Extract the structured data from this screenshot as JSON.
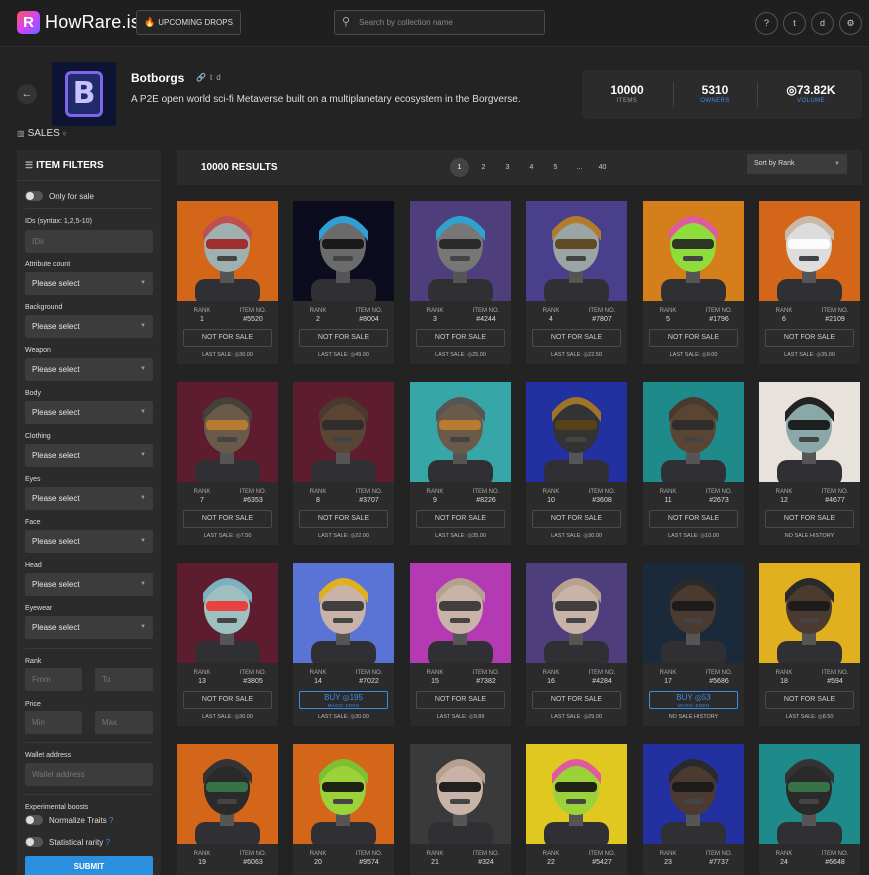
{
  "header": {
    "logo_letter": "R",
    "app_name": "HowRare.is",
    "upcoming_drops": "UPCOMING DROPS",
    "search_placeholder": "Search by collection name",
    "icons": [
      "help-icon",
      "twitter-icon",
      "discord-icon",
      "settings-icon"
    ],
    "icon_glyphs": [
      "?",
      "t",
      "d",
      "⚙"
    ]
  },
  "collection": {
    "name": "Botborgs",
    "logo_letter": "B",
    "links": [
      "link-icon",
      "twitter-icon",
      "discord-icon"
    ],
    "description": "A P2E open world sci-fi Metaverse built on a multiplanetary ecosystem in the Borgverse.",
    "stats": [
      {
        "value": "10000",
        "label": "ITEMS",
        "color": "#9a9a9a"
      },
      {
        "value": "5310",
        "label": "OWNERS",
        "color": "#3a8ee6"
      },
      {
        "value": "◎73.82K",
        "label": "VOLUME",
        "color": "#3a8ee6"
      }
    ]
  },
  "sales_label": "SALES",
  "filters": {
    "title": "ITEM FILTERS",
    "only_for_sale": "Only for sale",
    "ids_label": "IDs (syntax: 1,2,5-10)",
    "ids_placeholder": "IDs",
    "select_placeholder": "Please select",
    "attributes": [
      "Attribute count",
      "Background",
      "Weapon",
      "Body",
      "Clothing",
      "Eyes",
      "Face",
      "Head",
      "Eyewear"
    ],
    "rank_label": "Rank",
    "rank_from": "From",
    "rank_to": "To",
    "price_label": "Price",
    "price_min": "Min",
    "price_max": "Max",
    "wallet_label": "Wallet address",
    "wallet_placeholder": "Wallet address",
    "experimental_label": "Experimental boosts",
    "normalize_traits": "Normalize Traits",
    "statistical_rarity": "Statistical rarity",
    "help_mark": "?",
    "submit": "SUBMIT"
  },
  "results": {
    "count_text": "10000 RESULTS",
    "pages": [
      "1",
      "2",
      "3",
      "4",
      "5",
      "...",
      "40"
    ],
    "active_page": "1",
    "sort": "Sort by Rank"
  },
  "labels": {
    "rank": "RANK",
    "item_no": "ITEM NO.",
    "magic_eden": "MAGIC EDEN"
  },
  "items": [
    {
      "rank": "1",
      "item": "#5520",
      "sale": "NOT FOR SALE",
      "last": "LAST SALE: ◎30.00",
      "bg": "#d4661a",
      "skin": "#9fb0b0",
      "helmet": "#c05050",
      "visor": "#a02020"
    },
    {
      "rank": "2",
      "item": "#8004",
      "sale": "NOT FOR SALE",
      "last": "LAST SALE: ◎49.00",
      "bg": "#0b0d1e",
      "skin": "#6b6b6b",
      "helmet": "#2f9fd6",
      "visor": "#111"
    },
    {
      "rank": "3",
      "item": "#4244",
      "sale": "NOT FOR SALE",
      "last": "LAST SALE: ◎25.00",
      "bg": "#4e3f7c",
      "skin": "#777",
      "helmet": "#2fa3d0",
      "visor": "#222"
    },
    {
      "rank": "4",
      "item": "#7807",
      "sale": "NOT FOR SALE",
      "last": "LAST SALE: ◎22.50",
      "bg": "#4a3f8a",
      "skin": "#9aa6a6",
      "helmet": "#b07c2a",
      "visor": "#5a4216"
    },
    {
      "rank": "5",
      "item": "#1796",
      "sale": "NOT FOR SALE",
      "last": "LAST SALE: ◎9.00",
      "bg": "#d47f1c",
      "skin": "#8edd3a",
      "helmet": "#e05aa0",
      "visor": "#222"
    },
    {
      "rank": "6",
      "item": "#2109",
      "sale": "NOT FOR SALE",
      "last": "LAST SALE: ◎35.00",
      "bg": "#d4661a",
      "skin": "#ddd",
      "helmet": "#c9b9a8",
      "visor": "#fff"
    },
    {
      "rank": "7",
      "item": "#6353",
      "sale": "NOT FOR SALE",
      "last": "LAST SALE: ◎7.50",
      "bg": "#5e1d2e",
      "skin": "#6a5a4a",
      "helmet": "#44403a",
      "visor": "#c08030"
    },
    {
      "rank": "8",
      "item": "#3707",
      "sale": "NOT FOR SALE",
      "last": "LAST SALE: ◎22.00",
      "bg": "#5e1d2e",
      "skin": "#5a4434",
      "helmet": "#4a3a2e",
      "visor": "#2a2a2a"
    },
    {
      "rank": "9",
      "item": "#8226",
      "sale": "NOT FOR SALE",
      "last": "LAST SALE: ◎35.00",
      "bg": "#37a6a6",
      "skin": "#6a5a4a",
      "helmet": "#555",
      "visor": "#c08030"
    },
    {
      "rank": "10",
      "item": "#3608",
      "sale": "NOT FOR SALE",
      "last": "LAST SALE: ◎30.00",
      "bg": "#2230a0",
      "skin": "#333",
      "helmet": "#a07428",
      "visor": "#5a4216"
    },
    {
      "rank": "11",
      "item": "#2673",
      "sale": "NOT FOR SALE",
      "last": "LAST SALE: ◎10.00",
      "bg": "#1e8a8a",
      "skin": "#5a4434",
      "helmet": "#4a3a2e",
      "visor": "#2a2a2a"
    },
    {
      "rank": "12",
      "item": "#4677",
      "sale": "NOT FOR SALE",
      "last": "NO SALE HISTORY",
      "bg": "#e7e2dc",
      "skin": "#8aa8a8",
      "helmet": "#222",
      "visor": "#111"
    },
    {
      "rank": "13",
      "item": "#3805",
      "sale": "NOT FOR SALE",
      "last": "LAST SALE: ◎30.00",
      "bg": "#5e1d2e",
      "skin": "#9fc0c0",
      "helmet": "#7fb0c0",
      "visor": "#e33"
    },
    {
      "rank": "14",
      "item": "#7022",
      "sale": "BUY ◎195",
      "last": "LAST SALE: ◎30.00",
      "bg": "#5a74d6",
      "skin": "#c9b3a8",
      "helmet": "#e0b020",
      "visor": "#333"
    },
    {
      "rank": "15",
      "item": "#7382",
      "sale": "NOT FOR SALE",
      "last": "LAST SALE: ◎9.89",
      "bg": "#b33ab3",
      "skin": "#c9b3a8",
      "helmet": "#b6a090",
      "visor": "#333"
    },
    {
      "rank": "16",
      "item": "#4284",
      "sale": "NOT FOR SALE",
      "last": "LAST SALE: ◎29.00",
      "bg": "#4e3f7c",
      "skin": "#c9b3a8",
      "helmet": "#b6a090",
      "visor": "#333"
    },
    {
      "rank": "17",
      "item": "#5686",
      "sale": "BUY ◎53",
      "last": "NO SALE HISTORY",
      "bg": "#1b2a3a",
      "skin": "#4a3a30",
      "helmet": "#2a2a2a",
      "visor": "#1a1a1a"
    },
    {
      "rank": "18",
      "item": "#594",
      "sale": "NOT FOR SALE",
      "last": "LAST SALE: ◎8.50",
      "bg": "#e0b020",
      "skin": "#4a3a30",
      "helmet": "#2a2a2a",
      "visor": "#1a1a1a"
    },
    {
      "rank": "19",
      "item": "#6063",
      "sale": "",
      "last": "",
      "bg": "#d4661a",
      "skin": "#2a2a2a",
      "helmet": "#333",
      "visor": "#3a7a4a"
    },
    {
      "rank": "20",
      "item": "#9574",
      "sale": "",
      "last": "",
      "bg": "#d4661a",
      "skin": "#9bd23a",
      "helmet": "#7fc030",
      "visor": "#111"
    },
    {
      "rank": "21",
      "item": "#324",
      "sale": "",
      "last": "",
      "bg": "#3a3a3a",
      "skin": "#c9b3a8",
      "helmet": "#b6a090",
      "visor": "#111"
    },
    {
      "rank": "22",
      "item": "#5427",
      "sale": "",
      "last": "",
      "bg": "#e0c820",
      "skin": "#9bd23a",
      "helmet": "#e05aa0",
      "visor": "#111"
    },
    {
      "rank": "23",
      "item": "#7737",
      "sale": "",
      "last": "",
      "bg": "#2230a0",
      "skin": "#4a3a30",
      "helmet": "#2a2a2a",
      "visor": "#1a1a1a"
    },
    {
      "rank": "24",
      "item": "#6648",
      "sale": "",
      "last": "",
      "bg": "#1e8a8a",
      "skin": "#2a2a2a",
      "helmet": "#333",
      "visor": "#3a7a4a"
    }
  ]
}
